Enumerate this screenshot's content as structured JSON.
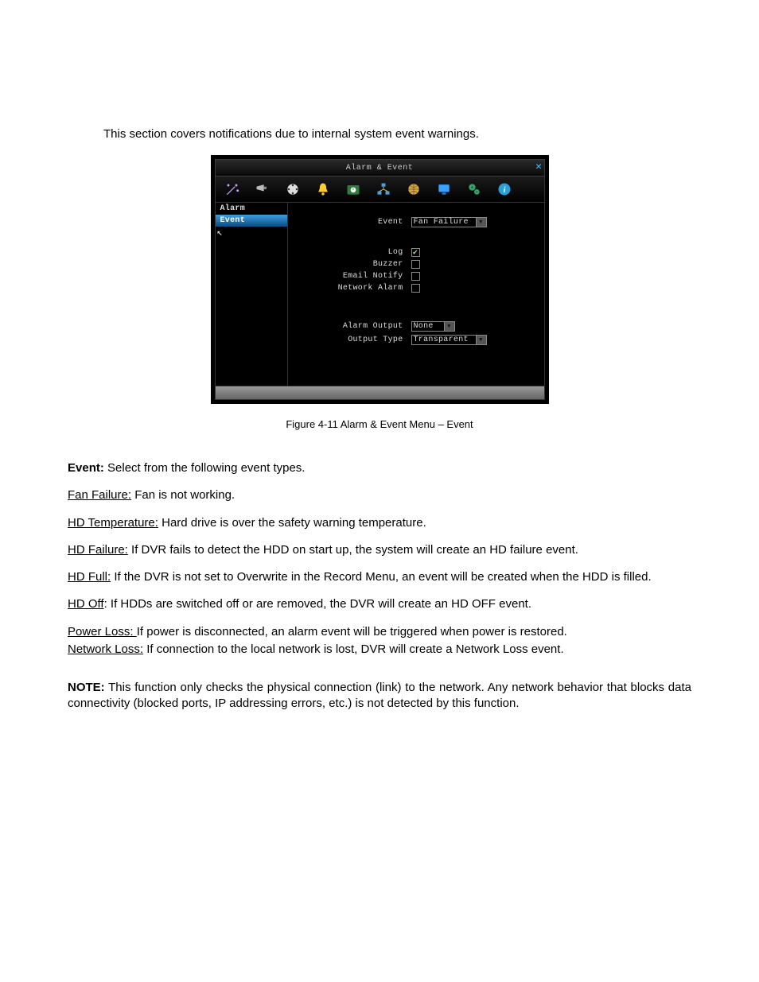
{
  "intro": "This section covers notifications due to internal system event warnings.",
  "window": {
    "title": "Alarm & Event",
    "close": "✕",
    "sidebar": {
      "items": [
        "Alarm",
        "Event"
      ],
      "highlighted": 1
    },
    "form": {
      "event_label": "Event",
      "event_value": "Fan Failure",
      "log_label": "Log",
      "log_checked": true,
      "buzzer_label": "Buzzer",
      "buzzer_checked": false,
      "email_label": "Email Notify",
      "email_checked": false,
      "netalarm_label": "Network Alarm",
      "netalarm_checked": false,
      "alarm_output_label": "Alarm Output",
      "alarm_output_value": "None",
      "output_type_label": "Output Type",
      "output_type_value": "Transparent"
    }
  },
  "figure_caption": "Figure 4-11  Alarm & Event Menu – Event",
  "defs": {
    "event_lead": "Event:",
    "event_rest": " Select from the following event types.",
    "fan_failure_u": "Fan Failure:",
    "fan_failure_rest": " Fan is not working.",
    "hd_temp_u": "HD Temperature:",
    "hd_temp_rest": " Hard drive is over the safety warning temperature.",
    "hd_failure_u": "HD Failure:",
    "hd_failure_rest": " If DVR fails to detect the HDD on start up, the system will create an HD failure event.",
    "hd_full_u": "HD Full:",
    "hd_full_rest": " If the DVR is not set to Overwrite in the Record Menu, an event will be created when the HDD is filled.",
    "hd_off_u": "HD Off",
    "hd_off_rest": ": If HDDs are switched off or are removed, the DVR will create an HD OFF event.",
    "power_loss_u": "Power Loss: ",
    "power_loss_rest": "If power is disconnected, an alarm event will be triggered when power is restored.",
    "network_loss_u": "Network Loss:",
    "network_loss_rest": " If connection to the local network is lost, DVR will create a Network Loss event.",
    "note_lead": "NOTE:",
    "note_rest": " This function only checks the physical connection (link) to the network. Any network behavior that blocks data connectivity (blocked ports, IP addressing errors, etc.) is not detected by this function."
  }
}
